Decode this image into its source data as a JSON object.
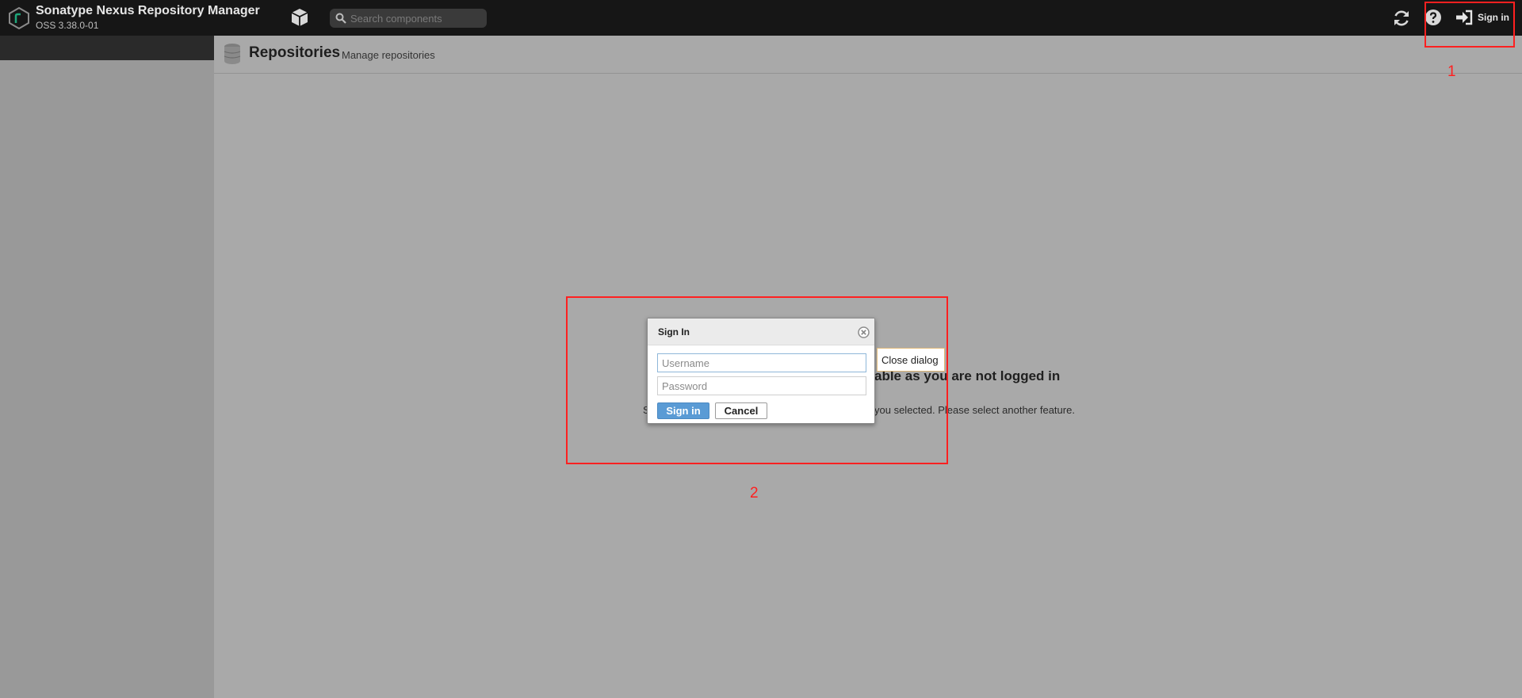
{
  "header": {
    "app_title": "Sonatype Nexus Repository Manager",
    "app_version": "OSS 3.38.0-01",
    "search_placeholder": "Search components",
    "sign_in_label": "Sign in",
    "icons": {
      "logo": "nexus-logo-icon",
      "browse": "cube-icon",
      "search": "search-icon",
      "refresh": "refresh-icon",
      "help": "help-icon",
      "sign_in": "sign-in-icon"
    }
  },
  "page": {
    "title": "Repositories",
    "subtitle": "Manage repositories",
    "icon": "database-icon"
  },
  "message": {
    "prefix": "S",
    "title": "able as you are not logged in",
    "body": "you selected. Please select another feature."
  },
  "dialog": {
    "title": "Sign In",
    "username_placeholder": "Username",
    "password_placeholder": "Password",
    "sign_in_button": "Sign in",
    "cancel_button": "Cancel",
    "close_tooltip": "Close dialog"
  },
  "annotations": {
    "label_1": "1",
    "label_2": "2",
    "color": "#ff2020"
  },
  "colors": {
    "topbar": "#161616",
    "overlay": "#a9a9a9",
    "primary_button": "#5a9bd5"
  }
}
